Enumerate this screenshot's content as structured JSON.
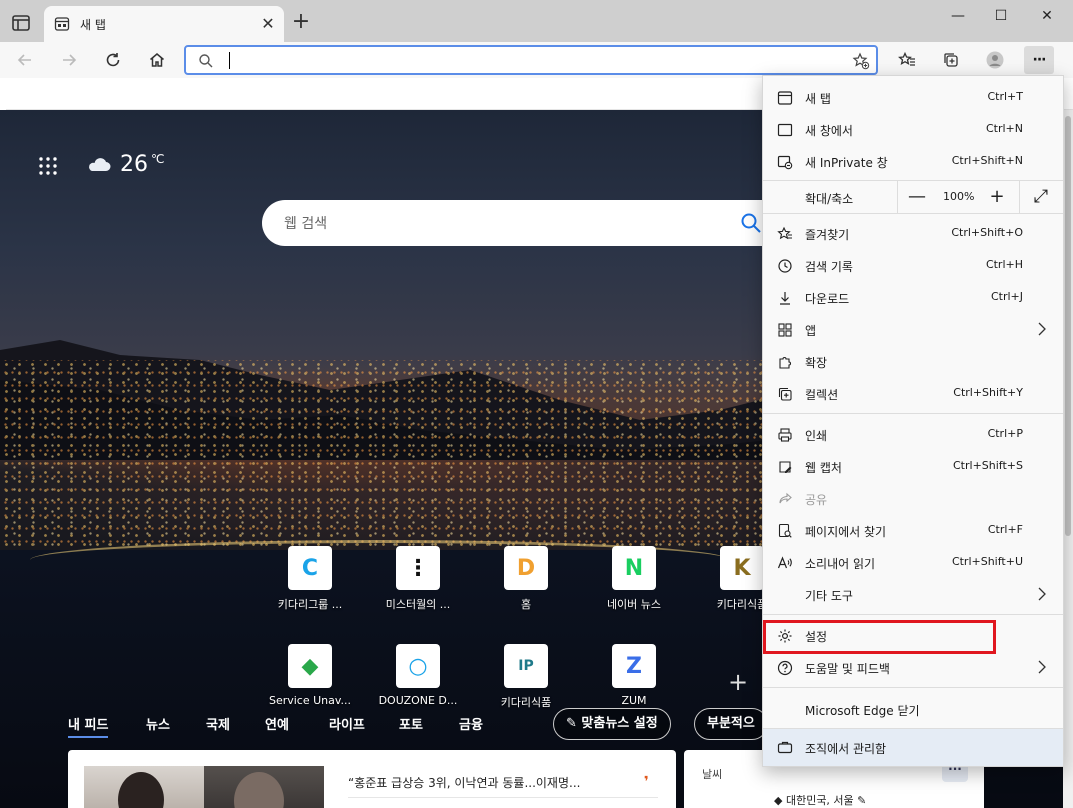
{
  "tab": {
    "title": "새 탭",
    "close": "✕"
  },
  "toolbar": {
    "new_tab": "+",
    "more": "···"
  },
  "window_controls": {
    "minimize": "—",
    "maximize": "☐",
    "close": "✕"
  },
  "newtab": {
    "weather_temp": "26",
    "weather_unit": "℃",
    "search_placeholder": "웹 검색",
    "quick_links": [
      {
        "label": "키다리그룹 ...",
        "color": "#1aa3e8",
        "glyph": "C"
      },
      {
        "label": "미스터월의 ...",
        "color": "#111111",
        "glyph": "⋮"
      },
      {
        "label": "홈",
        "color": "#f0a030",
        "glyph": "D"
      },
      {
        "label": "네이버 뉴스",
        "color": "#19ce60",
        "glyph": "N"
      },
      {
        "label": "키다리식품",
        "color": "#8a6d1f",
        "glyph": "K"
      },
      {
        "label": "Service Unav...",
        "color": "#2aa84a",
        "glyph": "◆"
      },
      {
        "label": "DOUZONE D...",
        "color": "#1aa3e8",
        "glyph": "○"
      },
      {
        "label": "키다리식품",
        "color": "#1f7a8a",
        "glyph": "IP"
      },
      {
        "label": "ZUM",
        "color": "#3a6ee8",
        "glyph": "Z"
      }
    ],
    "add_link": "+",
    "feed_tabs": [
      "내 피드",
      "뉴스",
      "국제",
      "연예",
      "라이프",
      "포토",
      "금융"
    ],
    "personalize_button": "✎ 맞춤뉴스 설정",
    "layout_button": "부분적으",
    "headline": "“홍준표 급상승 3위, 이낙연과 동률...이재명...",
    "headline_source": "❜",
    "weather_card_title": "날씨",
    "weather_card_more": "···",
    "weather_location": "◆ 대한민국, 서울 ✎"
  },
  "menu": {
    "items_top": [
      {
        "label": "새 탭",
        "shortcut": "Ctrl+T",
        "icon": "new-tab-icon"
      },
      {
        "label": "새 창에서",
        "shortcut": "Ctrl+N",
        "icon": "new-window-icon"
      },
      {
        "label": "새 InPrivate 창",
        "shortcut": "Ctrl+Shift+N",
        "icon": "inprivate-icon"
      }
    ],
    "zoom": {
      "label": "확대/축소",
      "minus": "—",
      "value": "100%",
      "plus": "+",
      "expand": "⤢"
    },
    "items_mid": [
      {
        "label": "즐겨찾기",
        "shortcut": "Ctrl+Shift+O",
        "icon": "favorites-icon"
      },
      {
        "label": "검색 기록",
        "shortcut": "Ctrl+H",
        "icon": "history-icon"
      },
      {
        "label": "다운로드",
        "shortcut": "Ctrl+J",
        "icon": "download-icon"
      },
      {
        "label": "앱",
        "shortcut": "",
        "icon": "apps-icon",
        "submenu": true
      },
      {
        "label": "확장",
        "shortcut": "",
        "icon": "extensions-icon"
      },
      {
        "label": "컬렉션",
        "shortcut": "Ctrl+Shift+Y",
        "icon": "collections-icon"
      }
    ],
    "items_tools": [
      {
        "label": "인쇄",
        "shortcut": "Ctrl+P",
        "icon": "print-icon"
      },
      {
        "label": "웹 캡처",
        "shortcut": "Ctrl+Shift+S",
        "icon": "web-capture-icon"
      },
      {
        "label": "공유",
        "shortcut": "",
        "icon": "share-icon",
        "disabled": true
      },
      {
        "label": "페이지에서 찾기",
        "shortcut": "Ctrl+F",
        "icon": "find-icon"
      },
      {
        "label": "소리내어 읽기",
        "shortcut": "Ctrl+Shift+U",
        "icon": "read-aloud-icon"
      },
      {
        "label": "기타 도구",
        "shortcut": "",
        "icon": "",
        "submenu": true
      }
    ],
    "settings": "설정",
    "help": "도움말 및 피드백",
    "close_edge": "Microsoft Edge 닫기",
    "managed": "조직에서 관리함"
  },
  "colors": {
    "highlight": "#e0171f",
    "address_border": "#5b8de8"
  }
}
